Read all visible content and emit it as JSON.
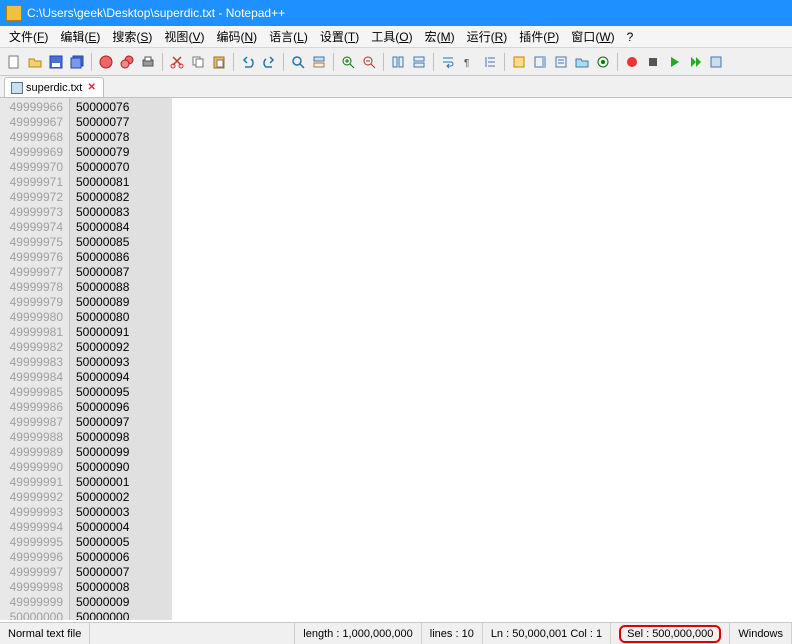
{
  "window": {
    "title": "C:\\Users\\geek\\Desktop\\superdic.txt - Notepad++"
  },
  "menu": {
    "file": {
      "label": "文件",
      "acc": "F"
    },
    "edit": {
      "label": "编辑",
      "acc": "E"
    },
    "search": {
      "label": "搜索",
      "acc": "S"
    },
    "view": {
      "label": "视图",
      "acc": "V"
    },
    "encoding": {
      "label": "编码",
      "acc": "N"
    },
    "language": {
      "label": "语言",
      "acc": "L"
    },
    "settings": {
      "label": "设置",
      "acc": "T"
    },
    "tools": {
      "label": "工具",
      "acc": "O"
    },
    "macro": {
      "label": "宏",
      "acc": "M"
    },
    "run": {
      "label": "运行",
      "acc": "R"
    },
    "plugins": {
      "label": "插件",
      "acc": "P"
    },
    "window": {
      "label": "窗口",
      "acc": "W"
    },
    "help": {
      "label": "?",
      "acc": ""
    }
  },
  "tab": {
    "name": "superdic.txt"
  },
  "rows": [
    {
      "ln": "49999966",
      "v": "50000076"
    },
    {
      "ln": "49999967",
      "v": "50000077"
    },
    {
      "ln": "49999968",
      "v": "50000078"
    },
    {
      "ln": "49999969",
      "v": "50000079"
    },
    {
      "ln": "49999970",
      "v": "50000070"
    },
    {
      "ln": "49999971",
      "v": "50000081"
    },
    {
      "ln": "49999972",
      "v": "50000082"
    },
    {
      "ln": "49999973",
      "v": "50000083"
    },
    {
      "ln": "49999974",
      "v": "50000084"
    },
    {
      "ln": "49999975",
      "v": "50000085"
    },
    {
      "ln": "49999976",
      "v": "50000086"
    },
    {
      "ln": "49999977",
      "v": "50000087"
    },
    {
      "ln": "49999978",
      "v": "50000088"
    },
    {
      "ln": "49999979",
      "v": "50000089"
    },
    {
      "ln": "49999980",
      "v": "50000080"
    },
    {
      "ln": "49999981",
      "v": "50000091"
    },
    {
      "ln": "49999982",
      "v": "50000092"
    },
    {
      "ln": "49999983",
      "v": "50000093"
    },
    {
      "ln": "49999984",
      "v": "50000094"
    },
    {
      "ln": "49999985",
      "v": "50000095"
    },
    {
      "ln": "49999986",
      "v": "50000096"
    },
    {
      "ln": "49999987",
      "v": "50000097"
    },
    {
      "ln": "49999988",
      "v": "50000098"
    },
    {
      "ln": "49999989",
      "v": "50000099"
    },
    {
      "ln": "49999990",
      "v": "50000090"
    },
    {
      "ln": "49999991",
      "v": "50000001"
    },
    {
      "ln": "49999992",
      "v": "50000002"
    },
    {
      "ln": "49999993",
      "v": "50000003"
    },
    {
      "ln": "49999994",
      "v": "50000004"
    },
    {
      "ln": "49999995",
      "v": "50000005"
    },
    {
      "ln": "49999996",
      "v": "50000006"
    },
    {
      "ln": "49999997",
      "v": "50000007"
    },
    {
      "ln": "49999998",
      "v": "50000008"
    },
    {
      "ln": "49999999",
      "v": "50000009"
    },
    {
      "ln": "50000000",
      "v": "50000000"
    }
  ],
  "status": {
    "type": "Normal text file",
    "lengthLabel": "length : 1,000,000,000",
    "linesLabel": "lines : 10",
    "posLabel": "Ln : 50,000,001    Col : 1",
    "selLabel": "Sel : 500,000,000",
    "eol": "Windows"
  }
}
